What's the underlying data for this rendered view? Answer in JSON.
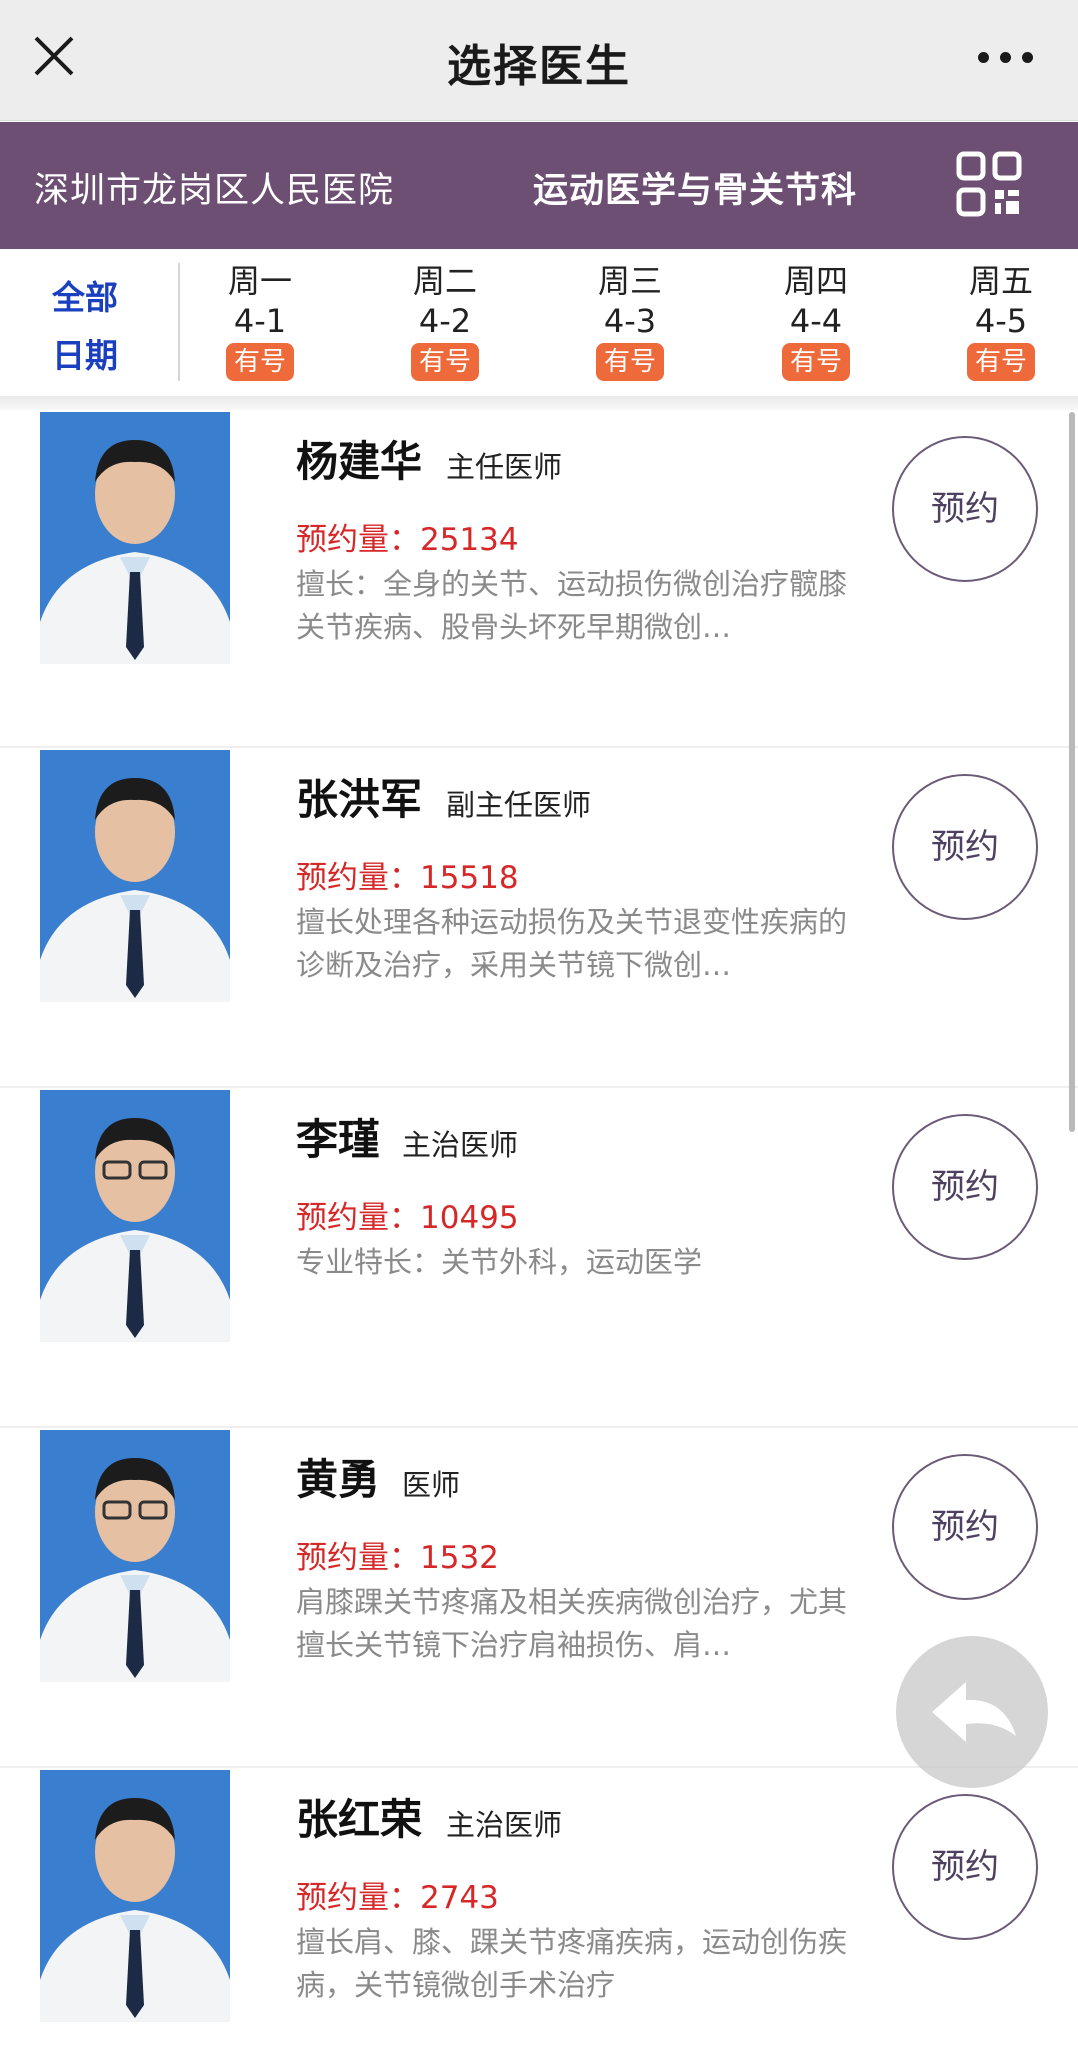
{
  "nav": {
    "title": "选择医生",
    "close_icon": "close-icon",
    "more_icon": "more-dots-icon"
  },
  "hospital": {
    "name": "深圳市龙岗区人民医院",
    "department": "运动医学与骨关节科",
    "qr_icon": "qr-code-icon",
    "bar_color": "#6d4f73"
  },
  "dates": {
    "all_line1": "全部",
    "all_line2": "日期",
    "days": [
      {
        "weekday": "周一",
        "date": "4-1",
        "status": "有号"
      },
      {
        "weekday": "周二",
        "date": "4-2",
        "status": "有号"
      },
      {
        "weekday": "周三",
        "date": "4-3",
        "status": "有号"
      },
      {
        "weekday": "周四",
        "date": "4-4",
        "status": "有号"
      },
      {
        "weekday": "周五",
        "date": "4-5",
        "status": "有号"
      }
    ]
  },
  "doctors": [
    {
      "name": "杨建华",
      "title": "主任医师",
      "count_label": "预约量：",
      "count": "25134",
      "desc": "擅长：全身的关节、运动损伤微创治疗髋膝关节疾病、股骨头坏死早期微创…",
      "book_label": "预约"
    },
    {
      "name": "张洪军",
      "title": "副主任医师",
      "count_label": "预约量：",
      "count": "15518",
      "desc": "擅长处理各种运动损伤及关节退变性疾病的诊断及治疗，采用关节镜下微创…",
      "book_label": "预约"
    },
    {
      "name": "李瑾",
      "title": "主治医师",
      "count_label": "预约量：",
      "count": "10495",
      "desc": "专业特长：关节外科，运动医学",
      "book_label": "预约"
    },
    {
      "name": "黄勇",
      "title": "医师",
      "count_label": "预约量：",
      "count": "1532",
      "desc": "肩膝踝关节疼痛及相关疾病微创治疗，尤其擅长关节镜下治疗肩袖损伤、肩…",
      "book_label": "预约"
    },
    {
      "name": "张红荣",
      "title": "主治医师",
      "count_label": "预约量：",
      "count": "2743",
      "desc": "擅长肩、膝、踝关节疼痛疾病，运动创伤疾病，关节镜微创手术治疗",
      "book_label": "预约"
    }
  ],
  "back_icon": "back-arrow-icon",
  "colors": {
    "accent_red": "#d62828",
    "badge_orange": "#ee6a3a",
    "all_dates_blue": "#1a3fbf"
  }
}
